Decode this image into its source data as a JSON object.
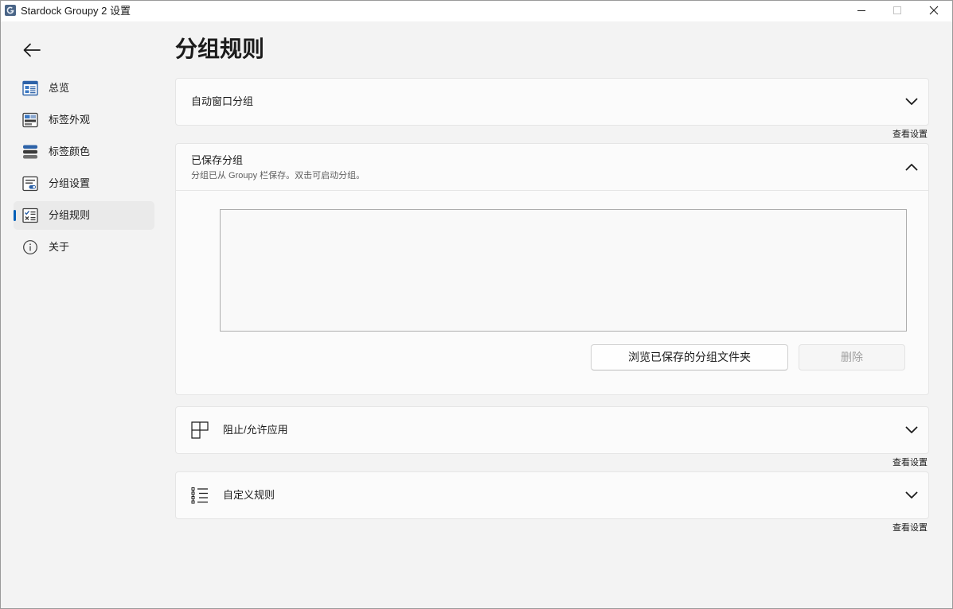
{
  "window": {
    "title": "Stardock Groupy 2 设置",
    "icons": {
      "app": "groupy-app-icon",
      "minimize": "minimize-icon",
      "maximize": "maximize-icon",
      "close": "close-icon"
    }
  },
  "sidebar": {
    "back_icon": "back-arrow-icon",
    "items": [
      {
        "label": "总览",
        "icon": "overview-icon",
        "selected": false
      },
      {
        "label": "标签外观",
        "icon": "tab-appearance-icon",
        "selected": false
      },
      {
        "label": "标签颜色",
        "icon": "tab-color-icon",
        "selected": false
      },
      {
        "label": "分组设置",
        "icon": "group-settings-icon",
        "selected": false
      },
      {
        "label": "分组规则",
        "icon": "group-rules-icon",
        "selected": true
      },
      {
        "label": "关于",
        "icon": "info-icon",
        "selected": false
      }
    ]
  },
  "main": {
    "title": "分组规则",
    "auto_grouping": {
      "title": "自动窗口分组",
      "expanded": false,
      "chevron_icon": "chevron-down-icon",
      "link": "查看设置"
    },
    "saved_groups": {
      "title": "已保存分组",
      "subtitle": "分组已从 Groupy 栏保存。双击可启动分组。",
      "expanded": true,
      "chevron_icon": "chevron-up-icon",
      "browse_button": "浏览已保存的分组文件夹",
      "delete_button": "删除",
      "delete_enabled": false
    },
    "block_allow_apps": {
      "title": "阻止/允许应用",
      "icon": "app-layout-icon",
      "expanded": false,
      "chevron_icon": "chevron-down-icon",
      "link": "查看设置"
    },
    "custom_rules": {
      "title": "自定义规则",
      "icon": "rules-list-icon",
      "expanded": false,
      "chevron_icon": "chevron-down-icon",
      "link": "查看设置"
    }
  },
  "colors": {
    "accent": "#005fb8",
    "window_background": "#f3f3f3",
    "titlebar_background": "#ffffff",
    "card_background": "#fbfbfb",
    "card_border": "#e5e5e5",
    "selected_nav_background": "#eaeaea",
    "subtitle_text": "#5f5f5f",
    "disabled_text": "#a0a0a0"
  }
}
